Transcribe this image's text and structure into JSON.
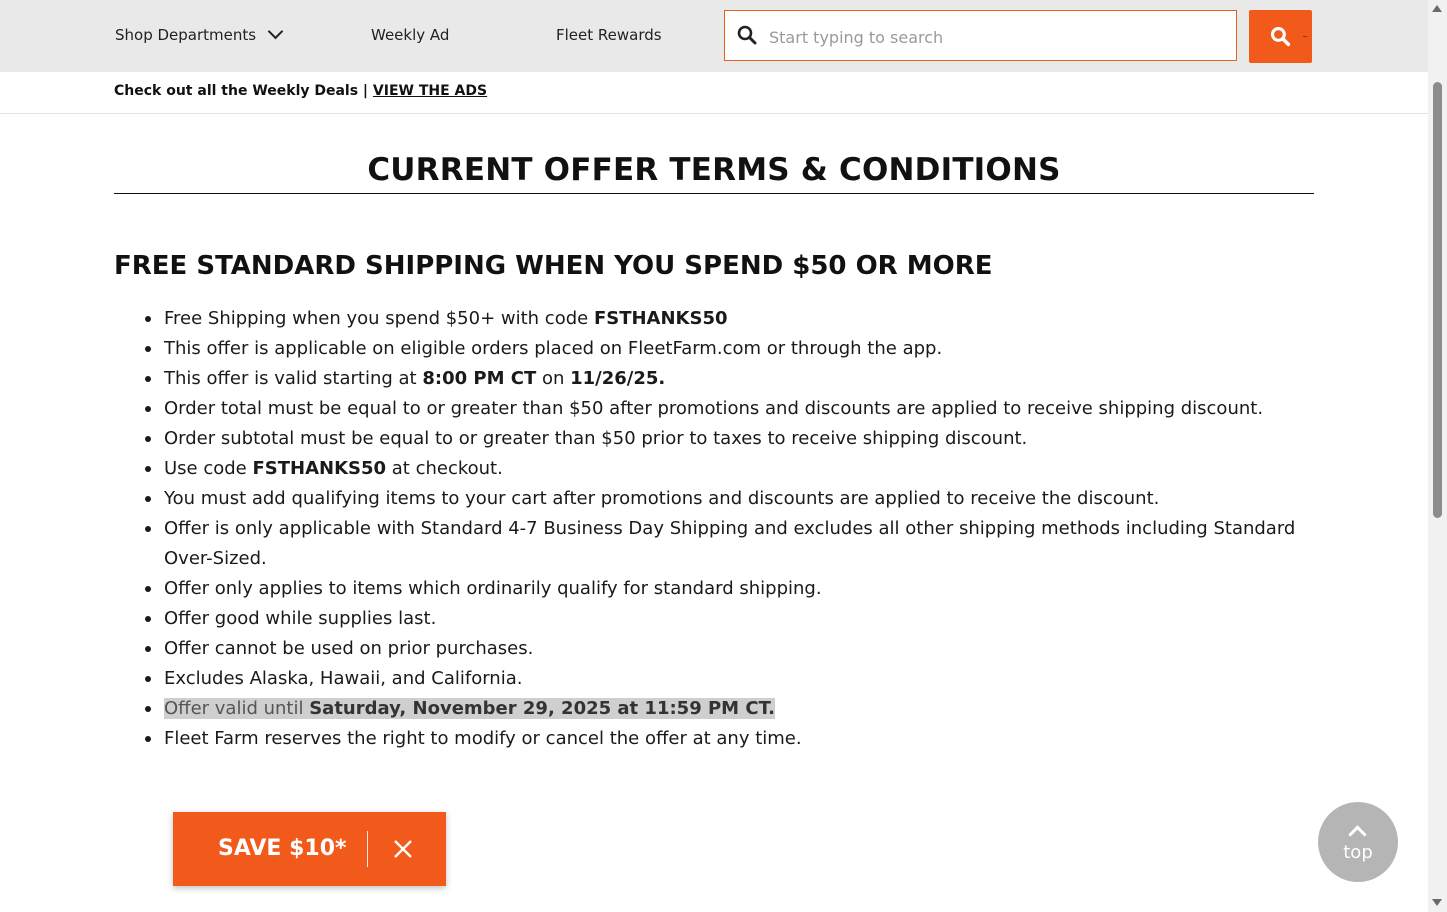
{
  "nav": {
    "shop_departments": "Shop Departments",
    "weekly_ad": "Weekly Ad",
    "fleet_rewards": "Fleet Rewards",
    "search_placeholder": "Start typing to search"
  },
  "promo": {
    "text": "Check out all the Weekly Deals | ",
    "link": "VIEW THE ADS"
  },
  "main": {
    "title": "CURRENT OFFER TERMS & CONDITIONS",
    "heading": "FREE STANDARD SHIPPING WHEN YOU SPEND $50 OR MORE",
    "terms": [
      [
        "Free Shipping when you spend $50+ with code ",
        "FSTHANKS50",
        ""
      ],
      [
        "This offer is applicable on eligible orders placed on FleetFarm.com or through the app."
      ],
      [
        "This offer is valid starting at ",
        "8:00 PM CT",
        " on ",
        "11/26/25."
      ],
      [
        "Order total must be equal to or greater than $50 after promotions and discounts are applied to receive shipping discount."
      ],
      [
        "Order subtotal must be equal to or greater than $50 prior to taxes to receive shipping discount."
      ],
      [
        "Use code ",
        "FSTHANKS50",
        " at checkout."
      ],
      [
        "You must add qualifying items to your cart after promotions and discounts are applied to receive the discount."
      ],
      [
        "Offer is only applicable with Standard 4-7 Business Day Shipping and excludes all other shipping methods including Standard Over-Sized."
      ],
      [
        "Offer only applies to items which ordinarily qualify for standard shipping."
      ],
      [
        "Offer good while supplies last."
      ],
      [
        "Offer cannot be used on prior purchases."
      ],
      [
        "Excludes Alaska, Hawaii, and California."
      ],
      [
        "Offer valid until ",
        "Saturday, November 29, 2025 at 11:59 PM CT."
      ],
      [
        "Fleet Farm reserves the right to modify or cancel the offer at any time."
      ]
    ]
  },
  "save_bar": {
    "label": "SAVE $10*"
  },
  "back_to_top": {
    "label": "top"
  },
  "colors": {
    "accent": "#f15a1b",
    "nav_bg": "#e9e9e9",
    "highlight": "#cfcfcf"
  },
  "icons": {
    "search": "search-icon",
    "chevron": "chevron-down-icon",
    "close": "close-icon",
    "caret_up": "caret-up-icon"
  }
}
